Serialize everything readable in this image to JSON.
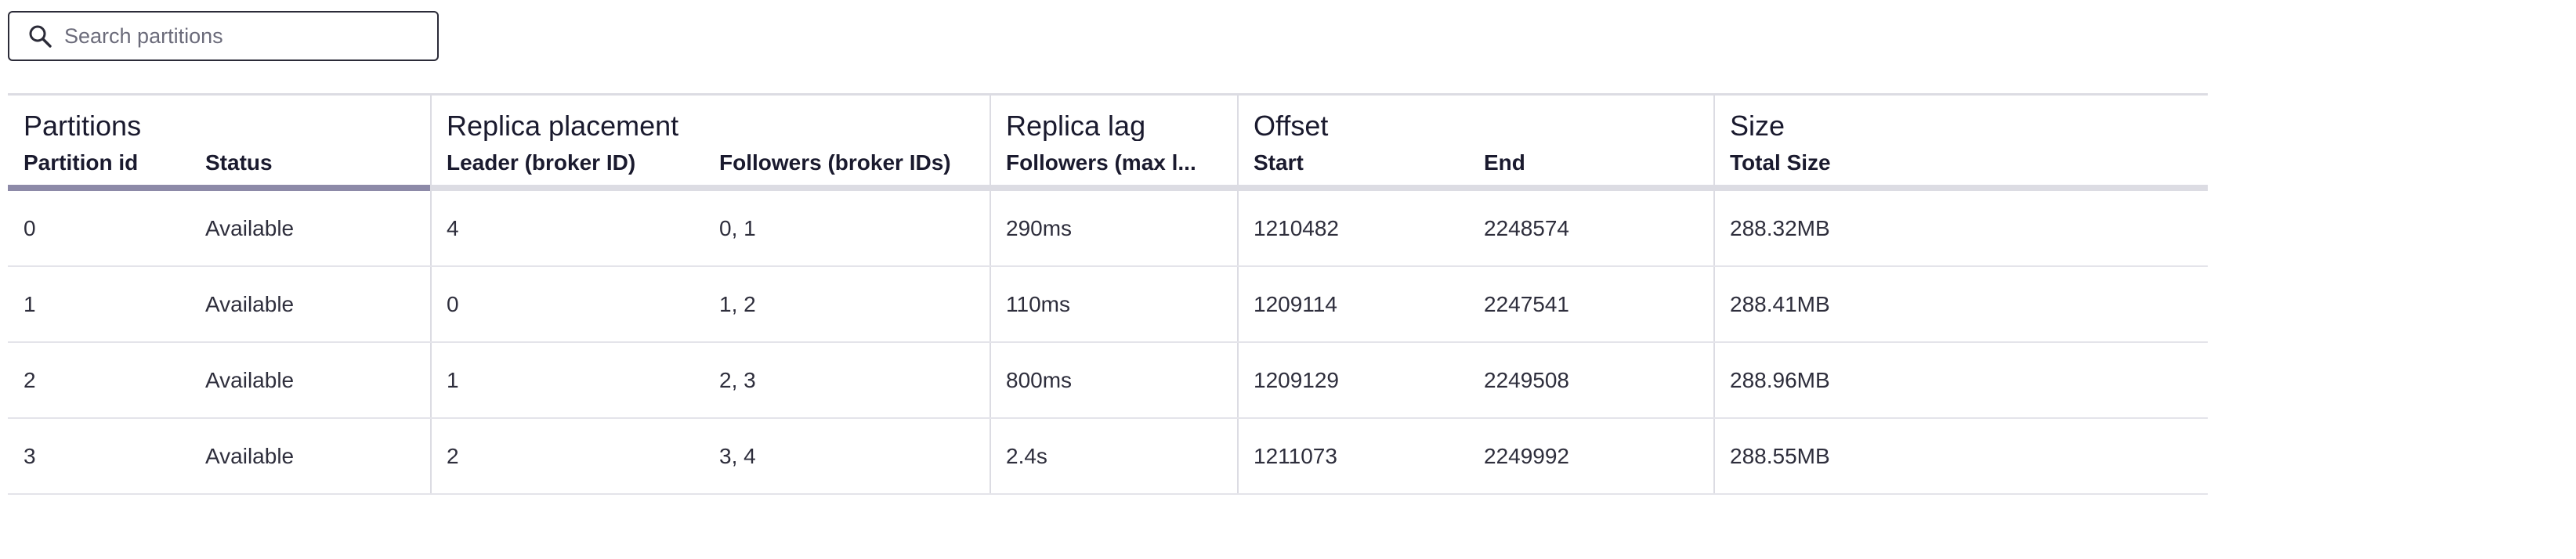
{
  "search": {
    "placeholder": "Search partitions",
    "icon": "search-icon"
  },
  "table": {
    "groups": [
      {
        "label": "Partitions"
      },
      {
        "label": "Replica placement"
      },
      {
        "label": "Replica lag"
      },
      {
        "label": "Offset"
      },
      {
        "label": "Size"
      }
    ],
    "columns": {
      "partition_id": "Partition id",
      "status": "Status",
      "leader": "Leader (broker ID)",
      "followers": "Followers (broker IDs)",
      "lag": "Followers (max l...",
      "start": "Start",
      "end": "End",
      "total_size": "Total Size"
    },
    "rows": [
      {
        "partition_id": "0",
        "status": "Available",
        "leader": "4",
        "followers": "0, 1",
        "lag": "290ms",
        "start": "1210482",
        "end": "2248574",
        "total_size": "288.32MB"
      },
      {
        "partition_id": "1",
        "status": "Available",
        "leader": "0",
        "followers": "1, 2",
        "lag": "110ms",
        "start": "1209114",
        "end": "2247541",
        "total_size": "288.41MB"
      },
      {
        "partition_id": "2",
        "status": "Available",
        "leader": "1",
        "followers": "2, 3",
        "lag": "800ms",
        "start": "1209129",
        "end": "2249508",
        "total_size": "288.96MB"
      },
      {
        "partition_id": "3",
        "status": "Available",
        "leader": "2",
        "followers": "3, 4",
        "lag": "2.4s",
        "start": "1211073",
        "end": "2249992",
        "total_size": "288.55MB"
      }
    ]
  },
  "colors": {
    "border": "#dcdce3",
    "active_sort_indicator": "#8d8aa8",
    "text": "#1a1a2e"
  }
}
